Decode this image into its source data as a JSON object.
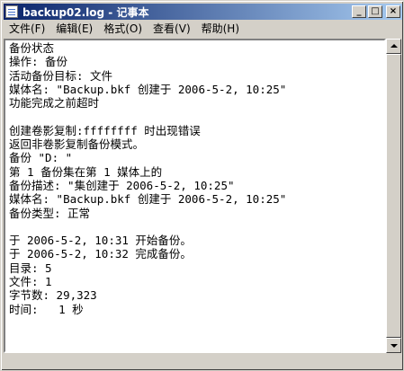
{
  "window": {
    "title": "backup02.log - 记事本",
    "buttons": {
      "minimize": "_",
      "maximize": "□",
      "close": "×"
    }
  },
  "menu": [
    {
      "label": "文件(F)"
    },
    {
      "label": "编辑(E)"
    },
    {
      "label": "格式(O)"
    },
    {
      "label": "查看(V)"
    },
    {
      "label": "帮助(H)"
    }
  ],
  "document": {
    "text": "备份状态\n操作: 备份\n活动备份目标: 文件\n媒体名: \"Backup.bkf 创建于 2006-5-2, 10:25\"\n功能完成之前超时\n\n创建卷影复制:ffffffff 时出现错误\n返回非卷影复制备份模式。\n备份 \"D: \"\n第 1 备份集在第 1 媒体上的\n备份描述: \"集创建于 2006-5-2, 10:25\"\n媒体名: \"Backup.bkf 创建于 2006-5-2, 10:25\"\n备份类型: 正常\n\n于 2006-5-2, 10:31 开始备份。\n于 2006-5-2, 10:32 完成备份。\n目录: 5\n文件: 1\n字节数: 29,323\n时间:   1 秒\n\n\n----------------------"
  },
  "icons": {
    "app": "notepad-icon",
    "scroll_up": "arrow-up-icon",
    "scroll_down": "arrow-down-icon"
  }
}
